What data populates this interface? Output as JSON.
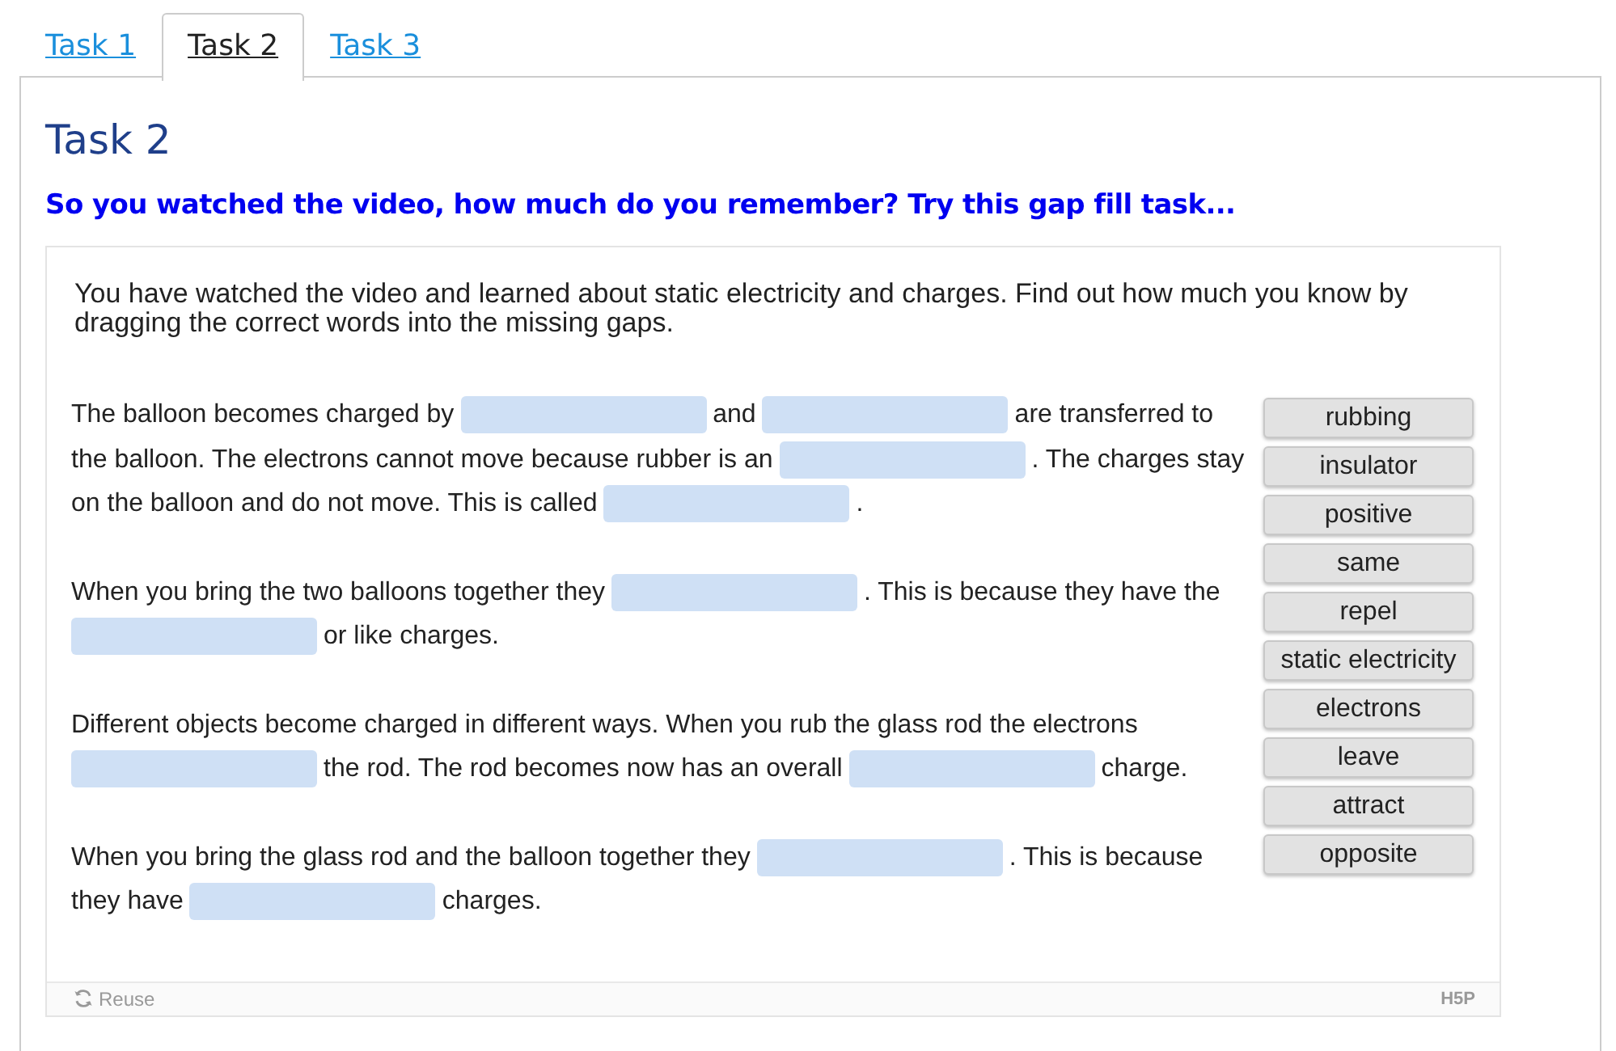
{
  "tabs": [
    {
      "label": "Task 1",
      "selected": false
    },
    {
      "label": "Task 2",
      "selected": true
    },
    {
      "label": "Task 3",
      "selected": false
    }
  ],
  "title": "Task 2",
  "subtitle": "So you watched the video, how much do you remember? Try this gap fill task...",
  "task": {
    "intro": "You have watched the video and learned about static electricity and charges. Find out how much you know by dragging the correct words into the missing gaps.",
    "paragraphs": [
      {
        "parts": [
          {
            "kind": "text",
            "text": "The balloon becomes charged by"
          },
          {
            "kind": "gap"
          },
          {
            "kind": "text",
            "text": "and"
          },
          {
            "kind": "gap"
          },
          {
            "kind": "text",
            "text": "are transferred to"
          },
          {
            "kind": "text",
            "text": "the balloon. The electrons cannot move because rubber is an"
          },
          {
            "kind": "gap"
          },
          {
            "kind": "text",
            "text": ". The charges stay"
          },
          {
            "kind": "text",
            "text": "on the balloon and do not move. This is called"
          },
          {
            "kind": "gap"
          },
          {
            "kind": "text",
            "text": "."
          }
        ]
      },
      {
        "parts": [
          {
            "kind": "text",
            "text": "When you bring the two balloons together they"
          },
          {
            "kind": "gap"
          },
          {
            "kind": "text",
            "text": ". This is because they have the"
          },
          {
            "kind": "gap"
          },
          {
            "kind": "text",
            "text": "or like charges."
          }
        ]
      },
      {
        "parts": [
          {
            "kind": "text",
            "text": "Different objects become charged in different ways. When you rub the glass rod the electrons"
          },
          {
            "kind": "gap"
          },
          {
            "kind": "text",
            "text": "the rod. The rod becomes now has an overall"
          },
          {
            "kind": "gap"
          },
          {
            "kind": "text",
            "text": "charge."
          }
        ]
      },
      {
        "parts": [
          {
            "kind": "text",
            "text": "When you bring the glass rod and the balloon together they"
          },
          {
            "kind": "gap"
          },
          {
            "kind": "text",
            "text": ". This is because"
          },
          {
            "kind": "text",
            "text": "they have"
          },
          {
            "kind": "gap"
          },
          {
            "kind": "text",
            "text": "charges."
          }
        ]
      }
    ],
    "words": [
      "rubbing",
      "insulator",
      "positive",
      "same",
      "repel",
      "static electricity",
      "electrons",
      "leave",
      "attract",
      "opposite"
    ],
    "reuse_label": "Reuse",
    "logo": "H5P"
  }
}
